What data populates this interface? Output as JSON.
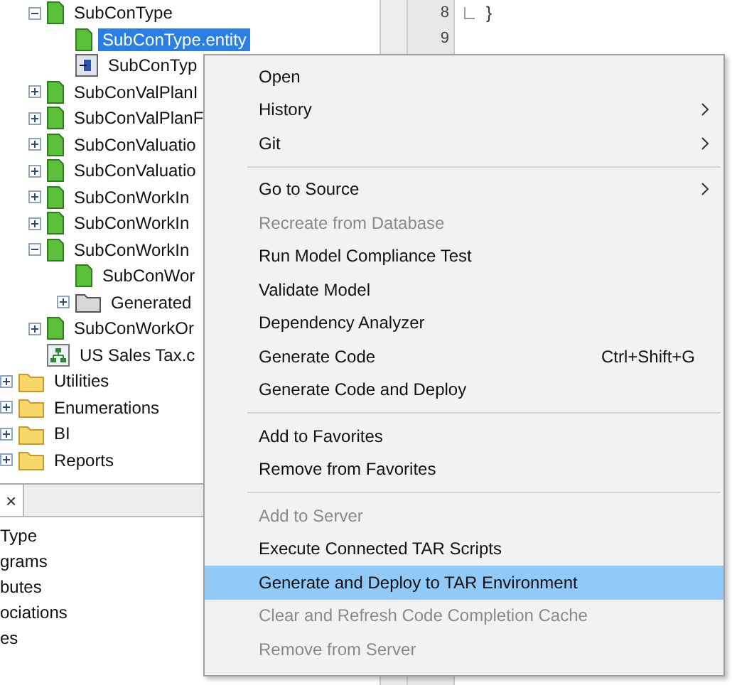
{
  "tree": {
    "continued_items": [
      {
        "label": "SubConType",
        "kind": "entity",
        "expanded": true,
        "selected": false,
        "children": [
          {
            "label": "SubConType.entity",
            "kind": "entity",
            "selected": true
          },
          {
            "label": "SubConTyp",
            "kind": "form",
            "selected": false
          }
        ]
      },
      {
        "label": "SubConValPlanI",
        "kind": "entity",
        "expanded": false,
        "selected": false
      },
      {
        "label": "SubConValPlanF",
        "kind": "entity",
        "expanded": false,
        "selected": false
      },
      {
        "label": "SubConValuatio",
        "kind": "entity",
        "expanded": false,
        "selected": false
      },
      {
        "label": "SubConValuatio",
        "kind": "entity",
        "expanded": false,
        "selected": false
      },
      {
        "label": "SubConWorkIn",
        "kind": "entity",
        "expanded": false,
        "selected": false
      },
      {
        "label": "SubConWorkIn",
        "kind": "entity",
        "expanded": false,
        "selected": false
      },
      {
        "label": "SubConWorkIn",
        "kind": "entity",
        "expanded": true,
        "selected": false,
        "children": [
          {
            "label": "SubConWor",
            "kind": "entity",
            "selected": false
          },
          {
            "label": "Generated",
            "kind": "generated-folder",
            "expanded": false,
            "selected": false
          }
        ]
      },
      {
        "label": "SubConWorkOr",
        "kind": "entity",
        "expanded": false,
        "selected": false
      },
      {
        "label": "US Sales Tax.c",
        "kind": "diagram",
        "selected": false
      }
    ],
    "items": [
      {
        "label": "Utilities",
        "kind": "folder",
        "expanded": false,
        "selected": false
      },
      {
        "label": "Enumerations",
        "kind": "folder",
        "expanded": false,
        "selected": false
      },
      {
        "label": "BI",
        "kind": "folder",
        "expanded": false,
        "selected": false
      },
      {
        "label": "Reports",
        "kind": "folder",
        "expanded": false,
        "selected": false
      }
    ]
  },
  "bottom_panel": {
    "tab_close": "×",
    "items": [
      "Type",
      "grams",
      "butes",
      "ociations",
      "es"
    ]
  },
  "editor": {
    "lines": [
      {
        "number": "8",
        "code": "}",
        "fold": true
      },
      {
        "number": "9",
        "fold": false
      }
    ]
  },
  "context_menu": [
    {
      "kind": "item",
      "label": "Open",
      "disabled": false,
      "selected": false,
      "submenu": false
    },
    {
      "kind": "item",
      "label": "History",
      "disabled": false,
      "selected": false,
      "submenu": true
    },
    {
      "kind": "item",
      "label": "Git",
      "disabled": false,
      "selected": false,
      "submenu": true
    },
    {
      "kind": "separator"
    },
    {
      "kind": "item",
      "label": "Go to Source",
      "disabled": false,
      "selected": false,
      "submenu": true
    },
    {
      "kind": "item",
      "label": "Recreate from Database",
      "disabled": true,
      "selected": false,
      "submenu": false
    },
    {
      "kind": "item",
      "label": "Run Model Compliance Test",
      "disabled": false,
      "selected": false,
      "submenu": false
    },
    {
      "kind": "item",
      "label": "Validate Model",
      "disabled": false,
      "selected": false,
      "submenu": false
    },
    {
      "kind": "item",
      "label": "Dependency Analyzer",
      "disabled": false,
      "selected": false,
      "submenu": false
    },
    {
      "kind": "item",
      "label": "Generate Code",
      "shortcut": "Ctrl+Shift+G",
      "disabled": false,
      "selected": false,
      "submenu": false
    },
    {
      "kind": "item",
      "label": "Generate Code and Deploy",
      "disabled": false,
      "selected": false,
      "submenu": false
    },
    {
      "kind": "separator"
    },
    {
      "kind": "item",
      "label": "Add to Favorites",
      "disabled": false,
      "selected": false,
      "submenu": false
    },
    {
      "kind": "item",
      "label": "Remove from Favorites",
      "disabled": false,
      "selected": false,
      "submenu": false
    },
    {
      "kind": "separator"
    },
    {
      "kind": "item",
      "label": "Add to Server",
      "disabled": true,
      "selected": false,
      "submenu": false
    },
    {
      "kind": "item",
      "label": "Execute Connected TAR Scripts",
      "disabled": false,
      "selected": false,
      "submenu": false
    },
    {
      "kind": "item",
      "label": "Generate and Deploy to TAR Environment",
      "disabled": false,
      "selected": true,
      "submenu": false
    },
    {
      "kind": "item",
      "label": "Clear and Refresh Code Completion Cache",
      "disabled": true,
      "selected": false,
      "submenu": false
    },
    {
      "kind": "item",
      "label": "Remove from Server",
      "disabled": true,
      "selected": false,
      "submenu": false
    }
  ]
}
